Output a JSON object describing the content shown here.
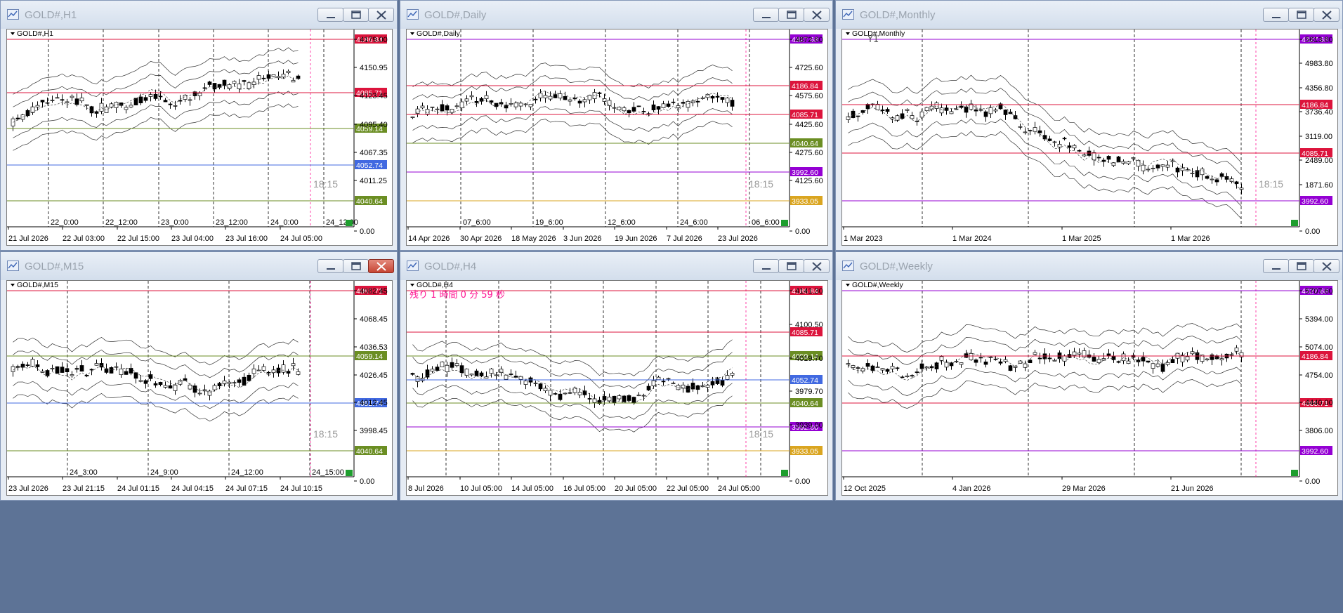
{
  "windows": [
    {
      "title": "GOLD#,H1",
      "label": "GOLD#,H1",
      "axis": [
        "4179.00",
        "4150.95",
        "4123.45",
        "4095.40",
        "4067.35",
        "4011.25",
        "0.00"
      ],
      "tags": [
        {
          "v": "4186.84",
          "c": "#dc143c"
        },
        {
          "v": "4085.71",
          "c": "#dc143c"
        },
        {
          "v": "4059.14",
          "c": "#6b8e23"
        },
        {
          "v": "4052.74",
          "c": "#4169e1"
        },
        {
          "v": "4040.64",
          "c": "#6b8e23"
        }
      ],
      "xlabels": [
        "21 Jul 2026",
        "22 Jul 03:00",
        "22 Jul 15:00",
        "23 Jul 04:00",
        "23 Jul 16:00",
        "24 Jul 05:00"
      ],
      "sessions": [
        "22_0:00",
        "22_12:00",
        "23_0:00",
        "23_12:00",
        "24_0:00",
        "24_12:00"
      ],
      "countdown": "18:15",
      "extra": ""
    },
    {
      "title": "GOLD#,Daily",
      "label": "GOLD#,Daily",
      "axis": [
        "4872.60",
        "4725.60",
        "4575.60",
        "4425.60",
        "4275.60",
        "4125.60",
        "0.00"
      ],
      "tags": [
        {
          "v": "4327.68",
          "c": "#9400d3"
        },
        {
          "v": "4186.84",
          "c": "#dc143c"
        },
        {
          "v": "4085.71",
          "c": "#dc143c"
        },
        {
          "v": "4040.64",
          "c": "#6b8e23"
        },
        {
          "v": "3992.60",
          "c": "#9400d3"
        },
        {
          "v": "3933.05",
          "c": "#daa520"
        }
      ],
      "xlabels": [
        "14 Apr 2026",
        "30 Apr 2026",
        "18 May 2026",
        "3 Jun 2026",
        "19 Jun 2026",
        "7 Jul 2026",
        "23 Jul 2026"
      ],
      "sessions": [
        "07_6:00",
        "19_6:00",
        "12_6:00",
        "24_6:00",
        "06_6:00"
      ],
      "countdown": "18:15",
      "extra": ""
    },
    {
      "title": "GOLD#,Monthly",
      "label": "GOLD#,Monthly",
      "axis": [
        "5613.80",
        "4983.80",
        "4356.80",
        "3736.40",
        "3119.00",
        "2489.00",
        "1871.60",
        "0.00"
      ],
      "tags": [
        {
          "v": "4327.68",
          "c": "#9400d3"
        },
        {
          "v": "4186.84",
          "c": "#dc143c"
        },
        {
          "v": "4085.71",
          "c": "#dc143c"
        },
        {
          "v": "3992.60",
          "c": "#9400d3"
        }
      ],
      "xlabels": [
        "1 Mar 2023",
        "1 Mar 2024",
        "1 Mar 2025",
        "1 Mar 2026"
      ],
      "sessions": [],
      "countdown": "18:15",
      "extra": "Y1"
    },
    {
      "title": "GOLD#,M15",
      "label": "GOLD#,M15",
      "axis": [
        "4082.45",
        "4068.45",
        "4036.53",
        "4026.45",
        "4012.45",
        "3998.45",
        "0.00"
      ],
      "tags": [
        {
          "v": "4085.71",
          "c": "#dc143c"
        },
        {
          "v": "4059.14",
          "c": "#6b8e23"
        },
        {
          "v": "4052.74",
          "c": "#4169e1"
        },
        {
          "v": "4040.64",
          "c": "#6b8e23"
        }
      ],
      "xlabels": [
        "23 Jul 2026",
        "23 Jul 21:15",
        "24 Jul 01:15",
        "24 Jul 04:15",
        "24 Jul 07:15",
        "24 Jul 10:15"
      ],
      "sessions": [
        "24_3:00",
        "24_9:00",
        "24_12:00",
        "24_15:00"
      ],
      "countdown": "18:15",
      "extra": ""
    },
    {
      "title": "GOLD#,H4",
      "label": "GOLD#,H4",
      "axis": [
        "4141.30",
        "4100.50",
        "4019.70",
        "3979.70",
        "3939.00",
        "0.00"
      ],
      "tags": [
        {
          "v": "4186.84",
          "c": "#dc143c"
        },
        {
          "v": "4085.71",
          "c": "#dc143c"
        },
        {
          "v": "4059.14",
          "c": "#6b8e23"
        },
        {
          "v": "4052.74",
          "c": "#4169e1"
        },
        {
          "v": "4040.64",
          "c": "#6b8e23"
        },
        {
          "v": "3992.60",
          "c": "#9400d3"
        },
        {
          "v": "3933.05",
          "c": "#daa520"
        }
      ],
      "xlabels": [
        "8 Jul 2026",
        "10 Jul 05:00",
        "14 Jul 05:00",
        "16 Jul 05:00",
        "20 Jul 05:00",
        "22 Jul 05:00",
        "24 Jul 05:00"
      ],
      "sessions": [],
      "countdown": "18:15",
      "extra": "残り 1 時間 0 分 59 秒"
    },
    {
      "title": "GOLD#,Weekly",
      "label": "GOLD#,Weekly",
      "axis": [
        "5707.60",
        "5394.00",
        "5074.00",
        "4754.00",
        "4440.00",
        "3806.00",
        "0.00"
      ],
      "tags": [
        {
          "v": "4327.68",
          "c": "#9400d3"
        },
        {
          "v": "4186.84",
          "c": "#dc143c"
        },
        {
          "v": "4085.71",
          "c": "#dc143c"
        },
        {
          "v": "3992.60",
          "c": "#9400d3"
        }
      ],
      "xlabels": [
        "12 Oct 2025",
        "4 Jan 2026",
        "29 Mar 2026",
        "21 Jun 2026"
      ],
      "sessions": [],
      "countdown": "",
      "extra": ""
    }
  ],
  "colors": {
    "frame": "#5d7396",
    "candle_up": "#ffffff",
    "candle_down": "#000000",
    "session": "#000000",
    "cursor": "#ff1493"
  }
}
